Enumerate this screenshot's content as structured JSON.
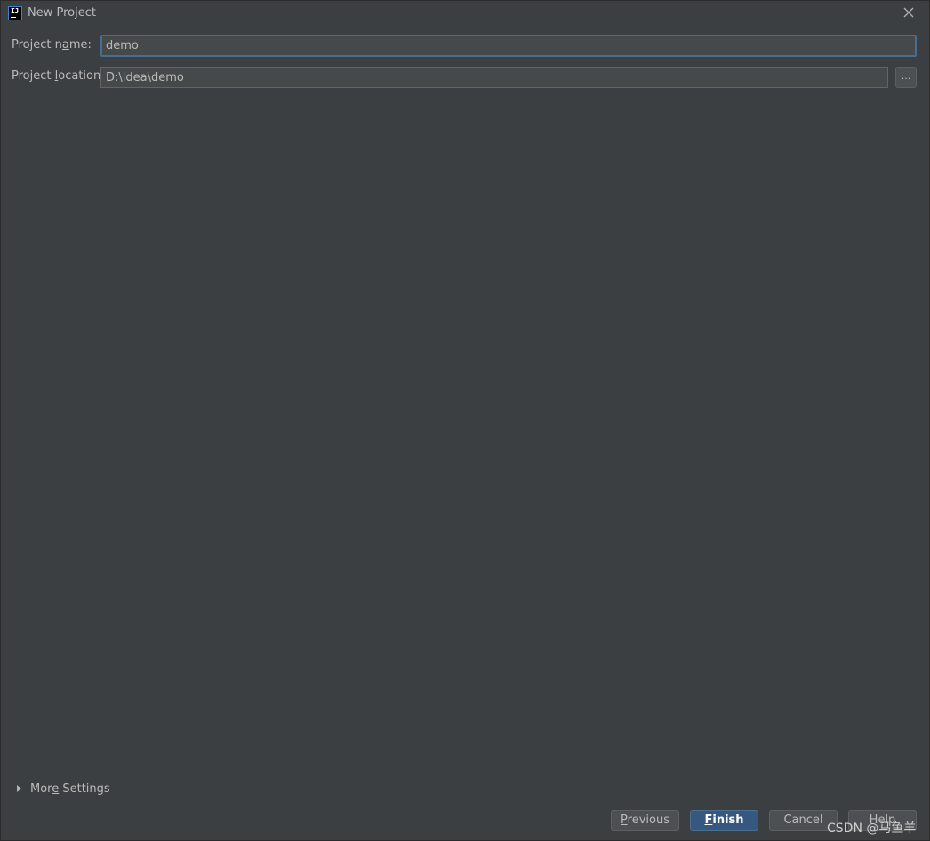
{
  "window": {
    "title": "New Project",
    "app_icon": "intellij-idea-icon",
    "close_icon": "close-icon"
  },
  "form": {
    "project_name": {
      "label_prefix": "Project n",
      "label_mnemonic": "a",
      "label_suffix": "me:",
      "value": "demo"
    },
    "project_location": {
      "label_prefix": "Project ",
      "label_mnemonic": "l",
      "label_suffix": "ocation:",
      "value": "D:\\idea\\demo",
      "browse_label": "..."
    }
  },
  "more_settings": {
    "label_prefix": "Mor",
    "label_mnemonic": "e",
    "label_suffix": " Settings",
    "expanded": false
  },
  "buttons": {
    "previous": {
      "mnemonic": "P",
      "rest": "revious"
    },
    "finish": {
      "mnemonic": "F",
      "rest": "inish"
    },
    "cancel": {
      "label": "Cancel"
    },
    "help": {
      "label": "Help"
    }
  },
  "watermark": "CSDN @马鱼羊",
  "colors": {
    "background": "#3c3f41",
    "input_bg": "#45494a",
    "focus_border": "#466d94",
    "primary_button": "#365880"
  }
}
